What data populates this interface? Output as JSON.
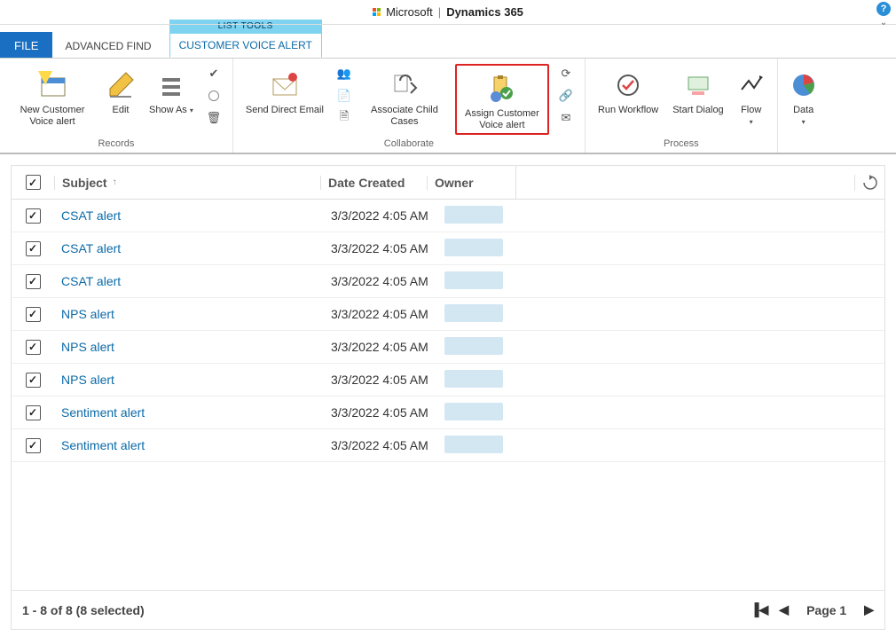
{
  "titlebar": {
    "brand": "Microsoft",
    "app": "Dynamics 365"
  },
  "tabs": {
    "file": "FILE",
    "advanced_find": "ADVANCED FIND",
    "list_tools": "LIST TOOLS",
    "customer_voice_alert": "CUSTOMER VOICE ALERT"
  },
  "ribbon": {
    "records": {
      "label": "Records",
      "new_alert": "New Customer Voice alert",
      "edit": "Edit",
      "show_as": "Show As"
    },
    "collaborate": {
      "label": "Collaborate",
      "send_email": "Send Direct Email",
      "associate": "Associate Child Cases",
      "assign": "Assign Customer Voice alert"
    },
    "process": {
      "label": "Process",
      "run_wf": "Run Workflow",
      "start_dlg": "Start Dialog",
      "flow": "Flow"
    },
    "data": {
      "label": "Data",
      "btn": "Data"
    }
  },
  "grid": {
    "columns": {
      "subject": "Subject",
      "date": "Date Created",
      "owner": "Owner"
    },
    "rows": [
      {
        "subject": "CSAT alert",
        "date": "3/3/2022 4:05 AM"
      },
      {
        "subject": "CSAT alert",
        "date": "3/3/2022 4:05 AM"
      },
      {
        "subject": "CSAT alert",
        "date": "3/3/2022 4:05 AM"
      },
      {
        "subject": "NPS alert",
        "date": "3/3/2022 4:05 AM"
      },
      {
        "subject": "NPS alert",
        "date": "3/3/2022 4:05 AM"
      },
      {
        "subject": "NPS alert",
        "date": "3/3/2022 4:05 AM"
      },
      {
        "subject": "Sentiment alert",
        "date": "3/3/2022 4:05 AM"
      },
      {
        "subject": "Sentiment alert",
        "date": "3/3/2022 4:05 AM"
      }
    ],
    "footer": {
      "summary": "1 - 8 of 8 (8 selected)",
      "page_label": "Page 1"
    }
  }
}
